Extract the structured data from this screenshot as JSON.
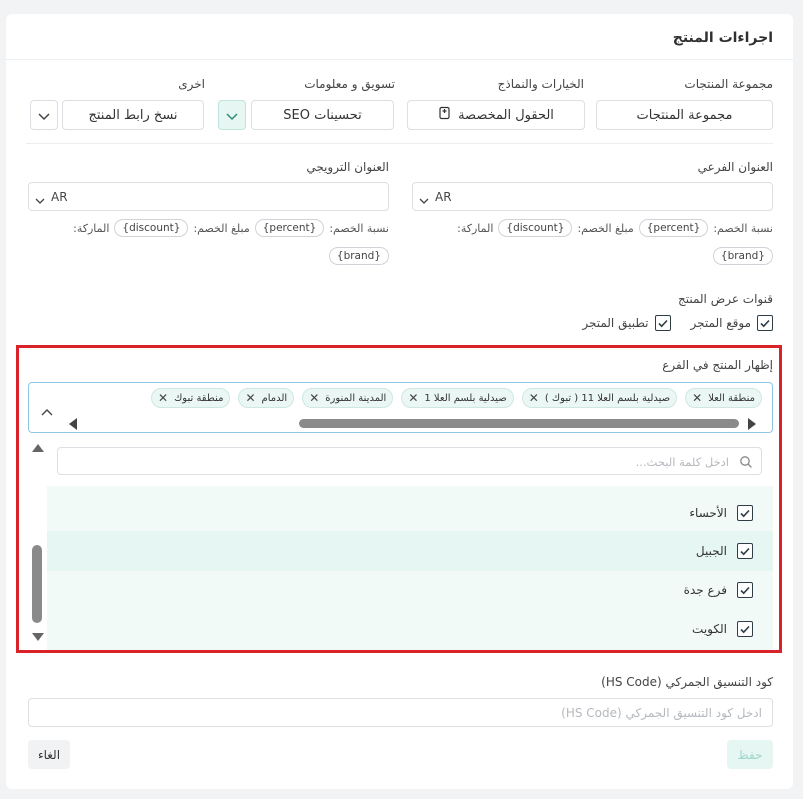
{
  "title": "اجراءات المنتج",
  "groups": {
    "product_group": {
      "label": "مجموعة المنتجات",
      "value": "مجموعة المنتجات"
    },
    "options_models": {
      "label": "الخيارات والنماذج",
      "value": "الحقول المخصصة"
    },
    "marketing": {
      "label": "تسويق و معلومات",
      "value": "تحسينات SEO"
    },
    "other": {
      "label": "اخرى",
      "value": "نسخ رابط المنتج"
    }
  },
  "subtitle_field": {
    "label": "العنوان الفرعي",
    "lang": "AR"
  },
  "promo_field": {
    "label": "العنوان الترويجي",
    "lang": "AR"
  },
  "hints": {
    "percent_label": "نسبة الخصم:",
    "percent_token": "{percent}",
    "amount_label": "مبلغ الخصم:",
    "amount_token": "{discount}",
    "brand_label": "الماركة:",
    "brand_token": "{brand}"
  },
  "channels": {
    "label": "قنوات عرض المنتج",
    "store_site": "موقع المتجر",
    "store_app": "تطبيق المتجر"
  },
  "branch": {
    "label": "إظهار المنتج في الفرع",
    "tags": [
      "منطقة العلا",
      "صيدلية بلسم العلا 11 ( تبوك )",
      "صيدلية بلسم العلا 1",
      "المدينة المنورة",
      "الدمام",
      "منطقة تبوك"
    ],
    "search_placeholder": "ادخل كلمة البحث...",
    "options": [
      "الأحساء",
      "الجبيل",
      "فرع جدة",
      "الكويت"
    ]
  },
  "hs_code": {
    "label": "كود التنسيق الجمركي (HS Code)",
    "placeholder": "ادخل كود التنسيق الجمركي (HS Code)"
  },
  "actions": {
    "save": "حفظ",
    "cancel": "الغاء"
  },
  "colors": {
    "accent": "#4fb8a4",
    "accent_light": "#e6f6f2",
    "highlight": "#d9222a"
  }
}
